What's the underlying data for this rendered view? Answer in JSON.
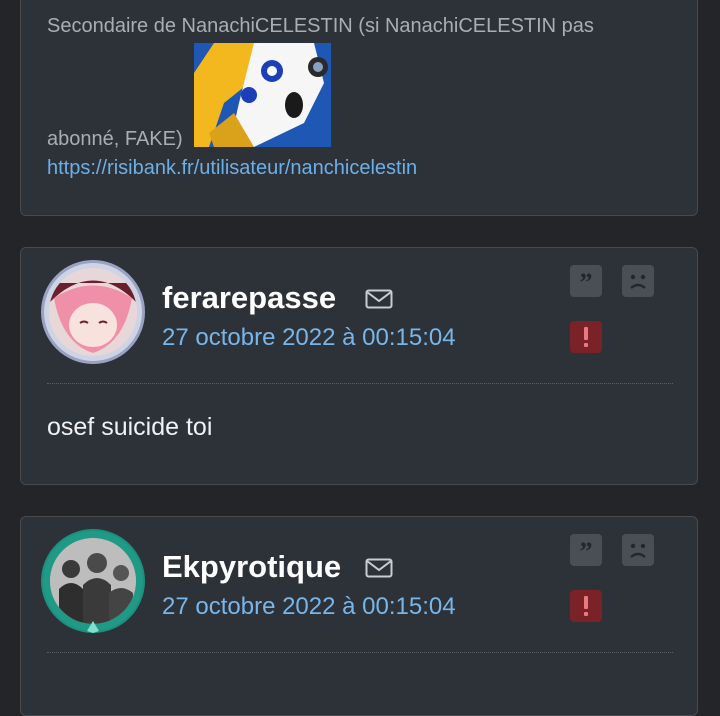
{
  "signature": {
    "line1": "Secondaire de NanachiCELESTIN (si NanachiCELESTIN pas",
    "line2": "abonné, FAKE)",
    "link": "https://risibank.fr/utilisateur/nanchicelestin",
    "sticker_icon": "anime-girl-sticker"
  },
  "posts": [
    {
      "username": "ferarepasse",
      "date": "27 octobre 2022 à 00:15:04",
      "message": "osef suicide toi",
      "avatar_icon": "anime-avatar"
    },
    {
      "username": "Ekpyrotique",
      "date": "27 octobre 2022 à 00:15:04",
      "message": "",
      "avatar_icon": "silhouettes-avatar"
    }
  ],
  "actions": {
    "quote_icon": "quote-icon",
    "sad_icon": "sad-face-icon",
    "report_icon": "report-icon",
    "mail_icon": "mail-icon"
  },
  "colors": {
    "background": "#232529",
    "card": "#2d3138",
    "link": "#6cb0e8",
    "date": "#78b6ea",
    "report": "#7a2227"
  }
}
